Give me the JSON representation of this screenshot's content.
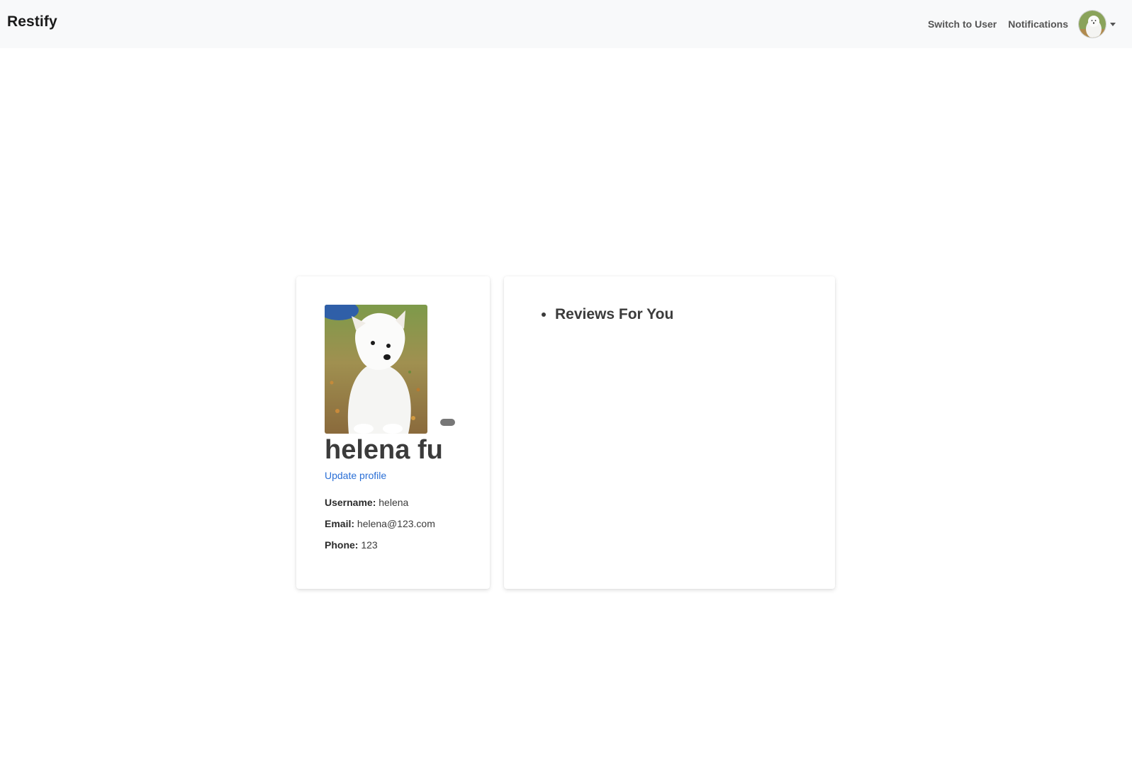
{
  "navbar": {
    "brand": "Restify",
    "links": [
      "Switch to User",
      "Notifications"
    ],
    "avatar_icon": "user-avatar-icon"
  },
  "profile": {
    "full_name": "helena fu",
    "update_link": "Update profile",
    "username_label": "Username:",
    "username": "helena",
    "email_label": "Email:",
    "email": "helena@123.com",
    "phone_label": "Phone:",
    "phone": "123"
  },
  "reviews": {
    "heading": "Reviews For You"
  },
  "colors": {
    "navbar_bg": "#f8f9fa",
    "link": "#2a6fd6",
    "text": "#3b3b3b"
  }
}
